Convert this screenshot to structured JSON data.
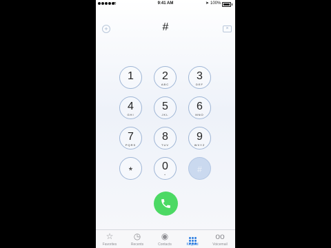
{
  "status_bar": {
    "time": "9:41 AM",
    "battery": "100%",
    "wifi_glyph": "≋",
    "location_glyph": "➤"
  },
  "keypad": {
    "display": "#",
    "add_glyph": "+",
    "delete_glyph": "×",
    "keys": [
      {
        "digit": "1",
        "letters": ""
      },
      {
        "digit": "2",
        "letters": "ABC"
      },
      {
        "digit": "3",
        "letters": "DEF"
      },
      {
        "digit": "4",
        "letters": "GHI"
      },
      {
        "digit": "5",
        "letters": "JKL"
      },
      {
        "digit": "6",
        "letters": "MNO"
      },
      {
        "digit": "7",
        "letters": "PQRS"
      },
      {
        "digit": "8",
        "letters": "TUV"
      },
      {
        "digit": "9",
        "letters": "WXYZ"
      },
      {
        "digit": "*",
        "letters": ""
      },
      {
        "digit": "0",
        "letters": "+"
      },
      {
        "digit": "#",
        "letters": ""
      }
    ]
  },
  "tabs": [
    {
      "label": "Favorites",
      "icon": "star-icon",
      "glyph": "☆"
    },
    {
      "label": "Recents",
      "icon": "clock-icon",
      "glyph": "◷"
    },
    {
      "label": "Contacts",
      "icon": "contact-icon",
      "glyph": "◉"
    },
    {
      "label": "Keypad",
      "icon": "keypad-icon",
      "glyph": ""
    },
    {
      "label": "Voicemail",
      "icon": "voicemail-icon",
      "glyph": "oo"
    }
  ],
  "colors": {
    "accent": "#2a7de1",
    "call": "#4cd964",
    "key_border": "#9fb6d6"
  }
}
